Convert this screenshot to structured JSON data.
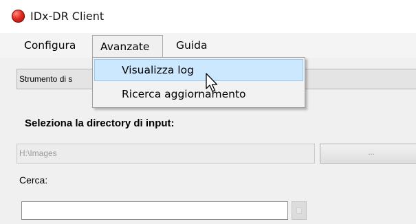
{
  "window": {
    "title": "IDx-DR Client",
    "icon": "app-icon-red-circle"
  },
  "menubar": {
    "items": [
      {
        "label": "Configura"
      },
      {
        "label": "Avanzate"
      },
      {
        "label": "Guida"
      }
    ]
  },
  "dropdown": {
    "items": [
      {
        "label": "Visualizza log"
      },
      {
        "label": "Ricerca aggiornamento"
      }
    ]
  },
  "main": {
    "tool_combo": {
      "value": "Strumento di s"
    },
    "input_dir_label": "Seleziona la directory di input:",
    "input_path": {
      "value": "H:\\Images"
    },
    "browse_button": {
      "label": "..."
    },
    "search_label": "Cerca:",
    "search_input": {
      "value": ""
    }
  },
  "colors": {
    "menu_highlight": "#cce8ff",
    "menu_highlight_border": "#99c9ef",
    "content_bg": "#f0f0f0",
    "app_icon": "#e0281c"
  }
}
